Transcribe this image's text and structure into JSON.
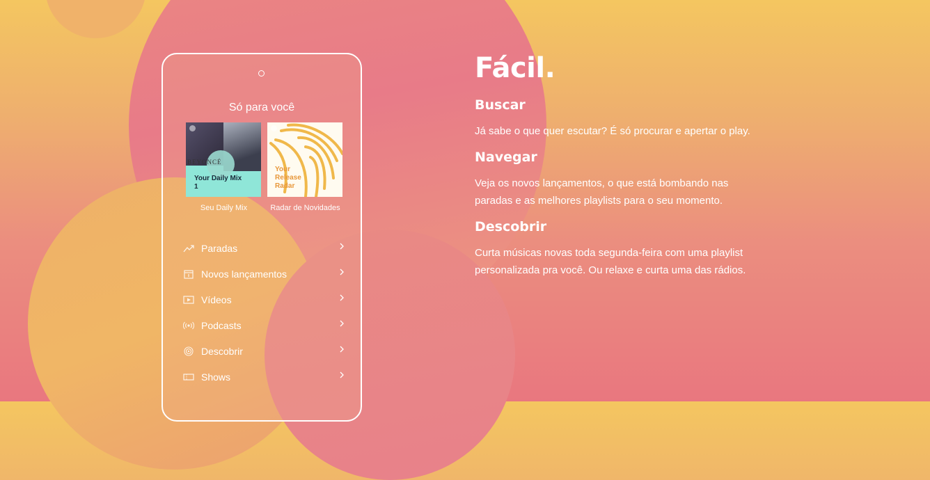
{
  "phone": {
    "section_title": "Só para você",
    "covers": [
      {
        "title": "Your Daily Mix 1",
        "caption": "Seu Daily Mix",
        "art_text": "BEYONCÉ",
        "accent": "#8fe6d8"
      },
      {
        "title": "Your Release Radar",
        "caption": "Radar de Novidades",
        "accent": "#f0b84a"
      }
    ],
    "menu": [
      {
        "label": "Paradas",
        "icon": "trending-icon"
      },
      {
        "label": "Novos lançamentos",
        "icon": "calendar-icon"
      },
      {
        "label": "Vídeos",
        "icon": "video-icon"
      },
      {
        "label": "Podcasts",
        "icon": "podcast-icon"
      },
      {
        "label": "Descobrir",
        "icon": "discover-icon"
      },
      {
        "label": "Shows",
        "icon": "ticket-icon"
      }
    ]
  },
  "content": {
    "heading": "Fácil.",
    "sections": [
      {
        "title": "Buscar",
        "text": "Já sabe o que quer escutar? É só procurar e apertar o play."
      },
      {
        "title": "Navegar",
        "text": "Veja os novos lançamentos, o que está bombando nas paradas e  as melhores playlists para o seu momento."
      },
      {
        "title": "Descobrir",
        "text": "Curta músicas novas toda segunda-feira com uma playlist personalizada pra você. Ou relaxe e curta uma das rádios."
      }
    ]
  },
  "colors": {
    "background_top": "#f4c660",
    "background_bottom": "#e9777f",
    "text": "#ffffff"
  }
}
